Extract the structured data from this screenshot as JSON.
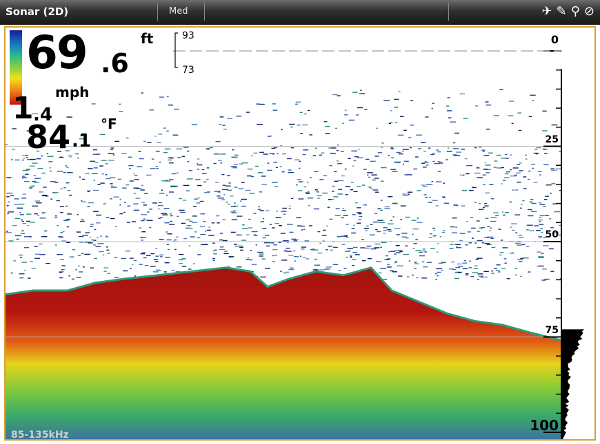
{
  "titlebar": {
    "title": "Sonar (2D)",
    "mode": "Med"
  },
  "icons": [
    "satellite-icon",
    "gps-signal-icon",
    "transducer-icon",
    "compass-icon"
  ],
  "readout": {
    "depth_int": "69",
    "depth_dec": ".6",
    "depth_unit": "ft",
    "speed_int": "1",
    "speed_dec": ".4",
    "speed_unit": "mph",
    "temp_int": "84",
    "temp_dec": ".1",
    "temp_unit": "°F"
  },
  "range": {
    "top": "93",
    "bottom": "73"
  },
  "depth_scale": {
    "labels": [
      "0",
      "25",
      "50",
      "75",
      "100"
    ],
    "max": 100
  },
  "frequency": "85-135kHz",
  "colors": {
    "accent_border": "#d9a031",
    "bottom_return": "#a3140f"
  }
}
